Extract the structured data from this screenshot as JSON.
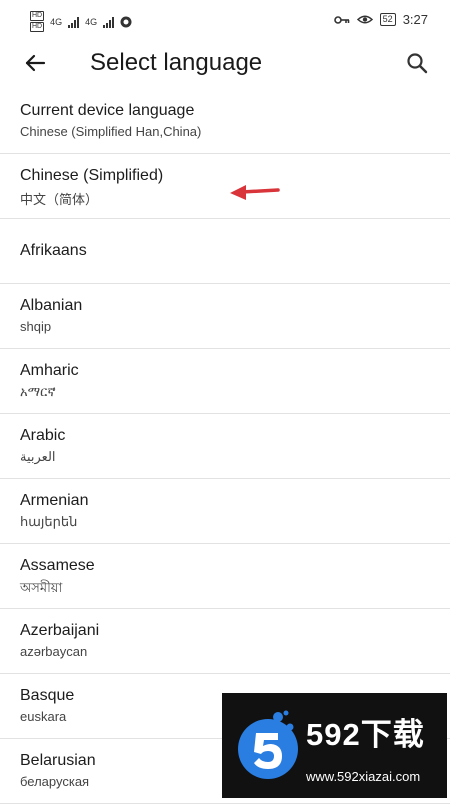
{
  "status_bar": {
    "sim1": "HD",
    "sim2": "HD",
    "network1": "4G",
    "network2": "4G",
    "battery": "52",
    "time": "3:27"
  },
  "app_bar": {
    "title": "Select language"
  },
  "languages": [
    {
      "primary": "Current device language",
      "secondary": "Chinese (Simplified Han,China)"
    },
    {
      "primary": "Chinese (Simplified)",
      "secondary": "中文（简体）"
    },
    {
      "primary": "Afrikaans",
      "secondary": ""
    },
    {
      "primary": "Albanian",
      "secondary": "shqip"
    },
    {
      "primary": "Amharic",
      "secondary": "አማርኛ"
    },
    {
      "primary": "Arabic",
      "secondary": "العربية"
    },
    {
      "primary": "Armenian",
      "secondary": "հայերեն"
    },
    {
      "primary": "Assamese",
      "secondary": "অসমীয়া"
    },
    {
      "primary": "Azerbaijani",
      "secondary": "azərbaycan"
    },
    {
      "primary": "Basque",
      "secondary": "euskara"
    },
    {
      "primary": "Belarusian",
      "secondary": "беларуская"
    }
  ],
  "watermark": {
    "brand": "592下载",
    "url": "www.592xiazai.com"
  },
  "icons": {
    "back": "arrow-back-icon",
    "search": "search-icon",
    "annotation": "red-arrow-icon"
  },
  "colors": {
    "annotation_arrow": "#d9343a",
    "watermark_bg": "#111111",
    "watermark_accent": "#2a7de1"
  }
}
